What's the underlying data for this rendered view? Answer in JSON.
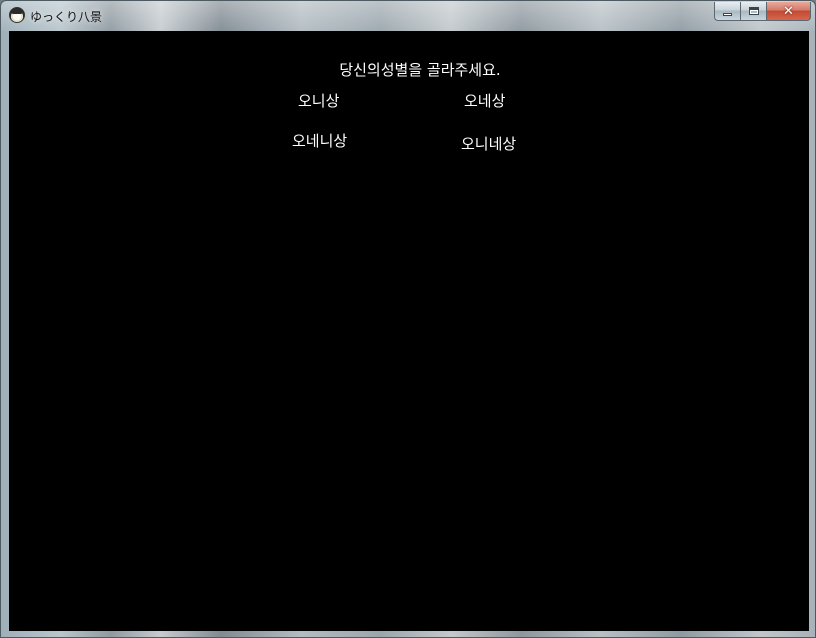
{
  "window": {
    "title": "ゆっくり八景",
    "minimize_icon": "minimize-icon",
    "maximize_icon": "maximize-icon",
    "close_label": "✕"
  },
  "game": {
    "prompt": "당신의성별을 골라주세요.",
    "choices": [
      {
        "label": "오니상"
      },
      {
        "label": "오네상"
      },
      {
        "label": "오네니상"
      },
      {
        "label": "오니네상"
      }
    ]
  },
  "colors": {
    "background": "#000000",
    "text": "#ffffff",
    "close_button": "#c24a34"
  }
}
